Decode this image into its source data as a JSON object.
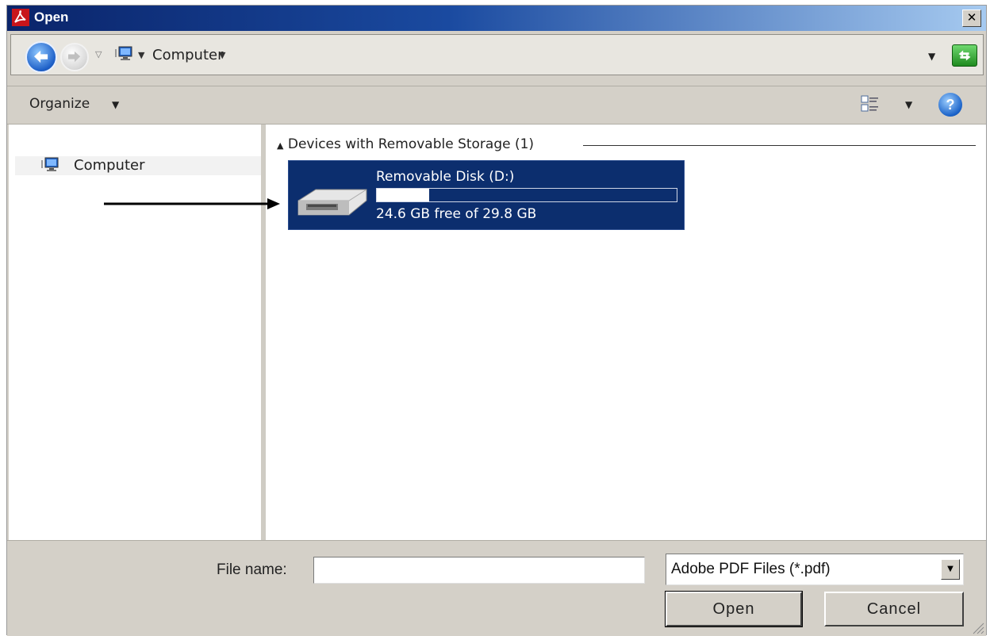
{
  "window": {
    "title": "Open"
  },
  "address_bar": {
    "location": "Computer"
  },
  "toolbar": {
    "organize_label": "Organize"
  },
  "nav_pane": {
    "items": [
      {
        "label": "Computer"
      }
    ]
  },
  "content": {
    "group": {
      "header": "Devices with Removable Storage (1)"
    },
    "drive": {
      "name": "Removable Disk (D:)",
      "free_text": "24.6 GB free of 29.8 GB",
      "used_fraction": 0.175
    }
  },
  "bottom": {
    "file_name_label": "File name:",
    "file_name_value": "",
    "file_type_selected": "Adobe PDF Files (*.pdf)",
    "open_label": "Open",
    "cancel_label": "Cancel"
  },
  "colors": {
    "titlebar_start": "#0a246a",
    "titlebar_end": "#a6caf0",
    "dialog_face": "#d4d0c8",
    "selection": "#0c2e6e"
  },
  "icons": [
    "acrobat-icon",
    "close-icon",
    "back-icon",
    "forward-icon",
    "recent-pages-icon",
    "computer-icon",
    "chevron-down-icon",
    "refresh-icon",
    "views-icon",
    "help-icon",
    "usb-drive-icon",
    "arrow-icon",
    "resize-grip-icon"
  ]
}
